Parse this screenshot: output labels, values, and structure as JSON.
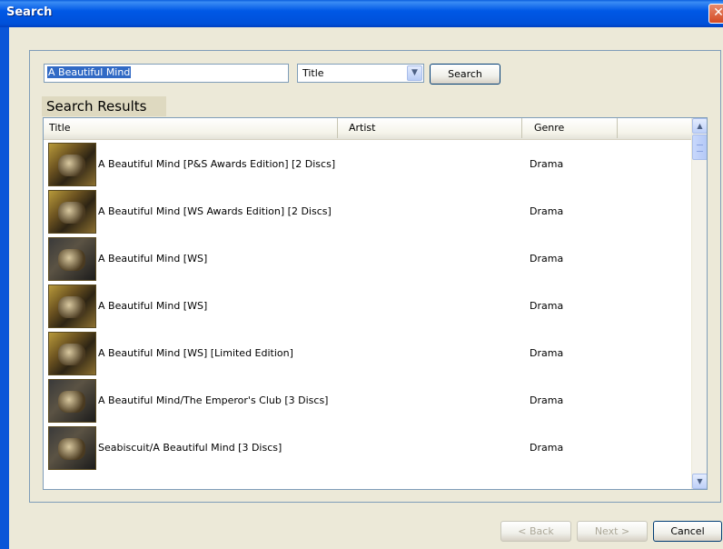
{
  "window": {
    "title": "Search",
    "close_glyph": "✕"
  },
  "search": {
    "query": "A Beautiful Mind",
    "field_selected": "Title",
    "search_button": "Search"
  },
  "results": {
    "label": "Search Results",
    "columns": [
      "Title",
      "Artist",
      "Genre"
    ],
    "rows": [
      {
        "title": "A Beautiful Mind [P&S Awards Edition] [2 Discs]",
        "artist": "",
        "genre": "Drama"
      },
      {
        "title": "A Beautiful Mind [WS Awards Edition] [2 Discs]",
        "artist": "",
        "genre": "Drama"
      },
      {
        "title": "A Beautiful Mind [WS]",
        "artist": "",
        "genre": "Drama"
      },
      {
        "title": "A Beautiful Mind [WS]",
        "artist": "",
        "genre": "Drama"
      },
      {
        "title": "A Beautiful Mind [WS] [Limited Edition]",
        "artist": "",
        "genre": "Drama"
      },
      {
        "title": "A Beautiful Mind/The Emperor's Club [3 Discs]",
        "artist": "",
        "genre": "Drama"
      },
      {
        "title": "Seabiscuit/A Beautiful Mind [3 Discs]",
        "artist": "",
        "genre": "Drama"
      }
    ]
  },
  "footer": {
    "back_label": "< Back",
    "next_label": "Next >",
    "cancel_label": "Cancel"
  },
  "icons": {
    "dropdown_arrow": "▼",
    "scroll_up": "▲",
    "scroll_down": "▼"
  },
  "colors": {
    "titlebar": "#0058e6",
    "selection": "#316ac5",
    "dialog_bg": "#ece9d8"
  }
}
